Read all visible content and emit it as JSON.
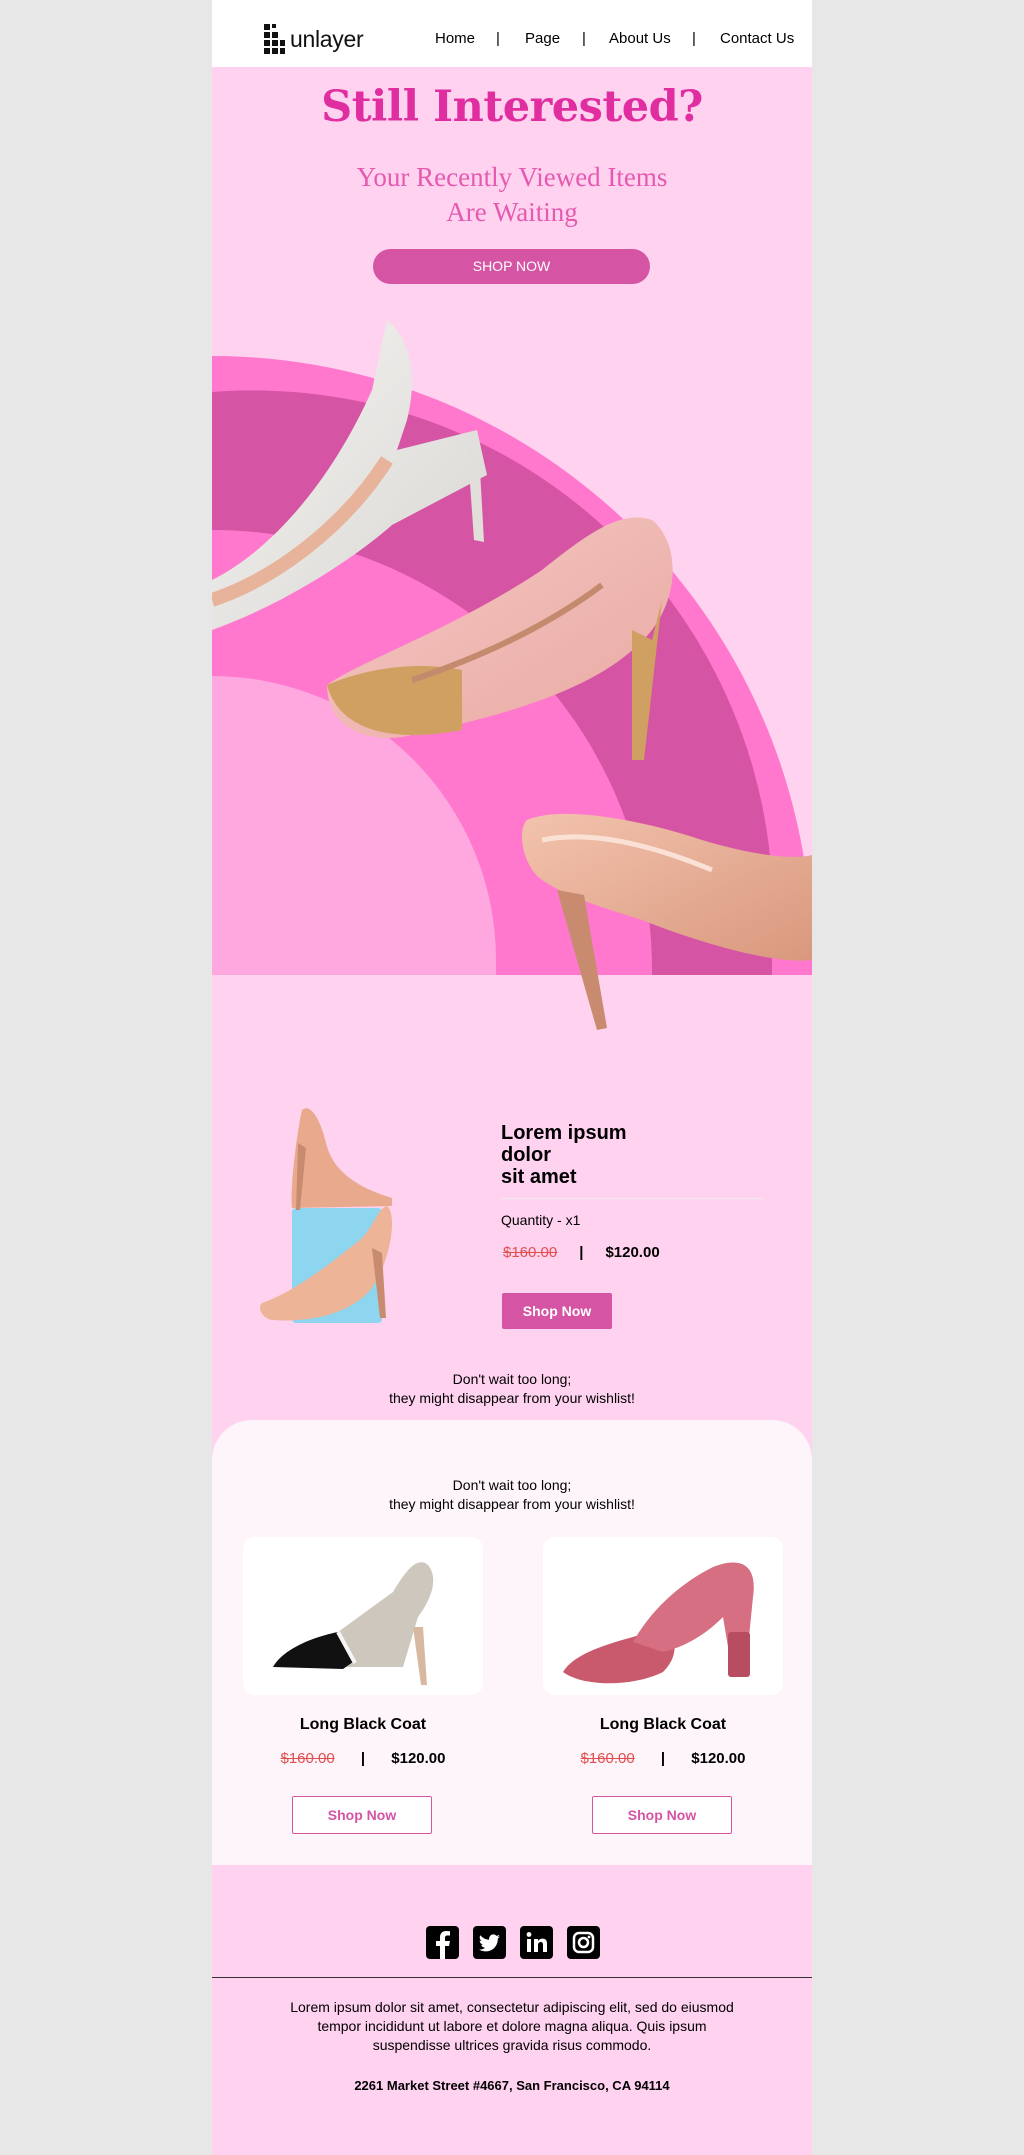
{
  "header": {
    "logo_text": "unlayer",
    "nav": [
      "Home",
      "Page",
      "About Us",
      "Contact Us"
    ],
    "separator": "|"
  },
  "hero": {
    "title": "Still Interested?",
    "subtitle_line1": "Your Recently Viewed Items",
    "subtitle_line2": "Are Waiting",
    "button": "SHOP NOW"
  },
  "product": {
    "title_line1": "Lorem ipsum",
    "title_line2": "dolor",
    "title_line3": "sit amet",
    "quantity": "Quantity - x1",
    "old_price": "$160.00",
    "separator": "|",
    "new_price": "$120.00",
    "button": "Shop Now"
  },
  "wait": {
    "line1": "Don't wait too long;",
    "line2": "they might disappear from your wishlist!"
  },
  "related": {
    "line1": "Don't wait too long;",
    "line2": "they might disappear from your wishlist!",
    "items": [
      {
        "title": "Long Black Coat",
        "old_price": "$160.00",
        "separator": "|",
        "new_price": "$120.00",
        "button": "Shop Now"
      },
      {
        "title": "Long Black Coat",
        "old_price": "$160.00",
        "separator": "|",
        "new_price": "$120.00",
        "button": "Shop Now"
      }
    ]
  },
  "footer": {
    "social_icons": [
      "facebook-icon",
      "twitter-icon",
      "linkedin-icon",
      "instagram-icon"
    ],
    "text_line1": "Lorem ipsum dolor sit amet, consectetur adipiscing elit, sed do eiusmod",
    "text_line2": "tempor incididunt ut labore et dolore magna aliqua. Quis ipsum",
    "text_line3": "suspendisse ultrices gravida risus commodo.",
    "address": "2261 Market Street #4667, San Francisco, CA 94114"
  },
  "colors": {
    "background": "#ffd2f0",
    "accent": "#d654a4",
    "title": "#e02d9f",
    "old_price": "#e05050"
  }
}
